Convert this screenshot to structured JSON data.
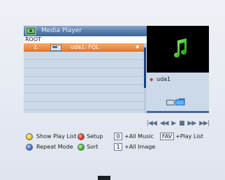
{
  "window": {
    "title": "Media Player",
    "path": "ROOT"
  },
  "file_list": {
    "rows": [
      {
        "number": "1.",
        "name": "uda1: FQL",
        "selected": true
      }
    ],
    "empty_rows": 8
  },
  "preview": {
    "icon": "music-note-icon",
    "current_file": "uda1",
    "bullet_icon": "red-diamond-icon",
    "progress": 0.0
  },
  "controls": [
    {
      "name": "previous-track",
      "glyph": "|◀◀"
    },
    {
      "name": "rewind",
      "glyph": "◀◀"
    },
    {
      "name": "play",
      "glyph": "▶"
    },
    {
      "name": "stop",
      "glyph": "■"
    },
    {
      "name": "fast-forward",
      "glyph": "▶▶"
    },
    {
      "name": "next-track",
      "glyph": "▶▶|"
    }
  ],
  "legend": {
    "show_play_list": "Show Play List",
    "setup": "Setup",
    "repeat_mode": "Repeat Mode",
    "sort": "Sort",
    "key_0": "0",
    "all_music": "+All Music",
    "key_1": "1",
    "all_image": "+All Image",
    "key_fav": "FAV",
    "play_list": "+Play List"
  },
  "colors": {
    "selection": "#ea7a2e",
    "title_bar": "#5b7eaf",
    "panel": "#cbd9e8",
    "preview_bg": "#000000",
    "note": "#3ec21f"
  }
}
